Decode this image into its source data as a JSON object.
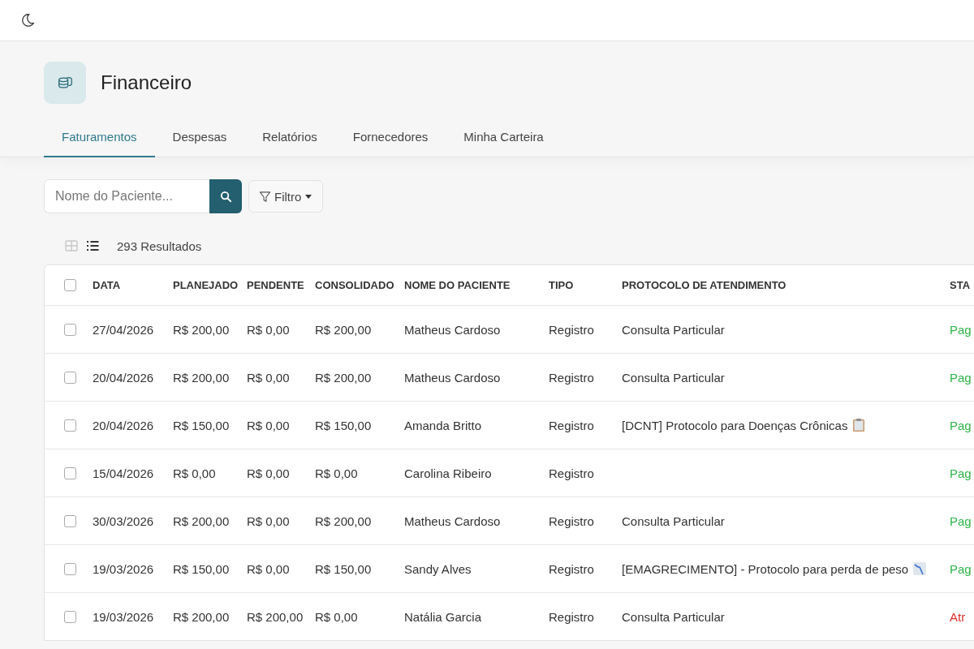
{
  "header": {
    "title": "Financeiro"
  },
  "tabs": [
    {
      "label": "Faturamentos",
      "selected": true
    },
    {
      "label": "Despesas",
      "selected": false
    },
    {
      "label": "Relatórios",
      "selected": false
    },
    {
      "label": "Fornecedores",
      "selected": false
    },
    {
      "label": "Minha Carteira",
      "selected": false
    }
  ],
  "search": {
    "placeholder": "Nome do Paciente..."
  },
  "filter_button": {
    "label": "Filtro"
  },
  "view_toggle": [
    {
      "kind": "grid",
      "selected": false
    },
    {
      "kind": "list",
      "selected": true
    }
  ],
  "result_count": "293 Resultados",
  "table": {
    "select_all_checked": false,
    "columns": [
      "DATA",
      "PLANEJADO",
      "PENDENTE",
      "CONSOLIDADO",
      "NOME DO PACIENTE",
      "TIPO",
      "PROTOCOLO DE ATENDIMENTO",
      "STA"
    ],
    "rows": [
      {
        "checked": false,
        "cells": [
          "27/04/2026",
          "R$ 200,00",
          "R$ 0,00",
          "R$ 200,00",
          "Matheus Cardoso",
          "Registro",
          "Consulta Particular"
        ],
        "status": {
          "text": "Pag",
          "kind": "paid"
        }
      },
      {
        "checked": false,
        "cells": [
          "20/04/2026",
          "R$ 200,00",
          "R$ 0,00",
          "R$ 200,00",
          "Matheus Cardoso",
          "Registro",
          "Consulta Particular"
        ],
        "status": {
          "text": "Pag",
          "kind": "paid"
        }
      },
      {
        "checked": false,
        "cells": [
          "20/04/2026",
          "R$ 150,00",
          "R$ 0,00",
          "R$ 150,00",
          "Amanda Britto",
          "Registro",
          "[DCNT] Protocolo para Doenças Crônicas"
        ],
        "protocol_icon": {
          "kind": "clipboard"
        },
        "status": {
          "text": "Pag",
          "kind": "paid"
        }
      },
      {
        "checked": false,
        "cells": [
          "15/04/2026",
          "R$ 0,00",
          "R$ 0,00",
          "R$ 0,00",
          "Carolina Ribeiro",
          "Registro"
        ],
        "status": {
          "text": "Pag",
          "kind": "paid"
        }
      },
      {
        "checked": false,
        "cells": [
          "30/03/2026",
          "R$ 200,00",
          "R$ 0,00",
          "R$ 200,00",
          "Matheus Cardoso",
          "Registro",
          "Consulta Particular"
        ],
        "status": {
          "text": "Pag",
          "kind": "paid"
        }
      },
      {
        "checked": false,
        "cells": [
          "19/03/2026",
          "R$ 150,00",
          "R$ 0,00",
          "R$ 150,00",
          "Sandy Alves",
          "Registro",
          "[EMAGRECIMENTO] - Protocolo para perda de peso"
        ],
        "protocol_icon": {
          "kind": "chart"
        },
        "status": {
          "text": "Pag",
          "kind": "paid"
        }
      },
      {
        "checked": false,
        "cells": [
          "19/03/2026",
          "R$ 200,00",
          "R$ 200,00",
          "R$ 0,00",
          "Natália Garcia",
          "Registro",
          "Consulta Particular"
        ],
        "status": {
          "text": "Atr",
          "kind": "overdue"
        }
      }
    ]
  }
}
